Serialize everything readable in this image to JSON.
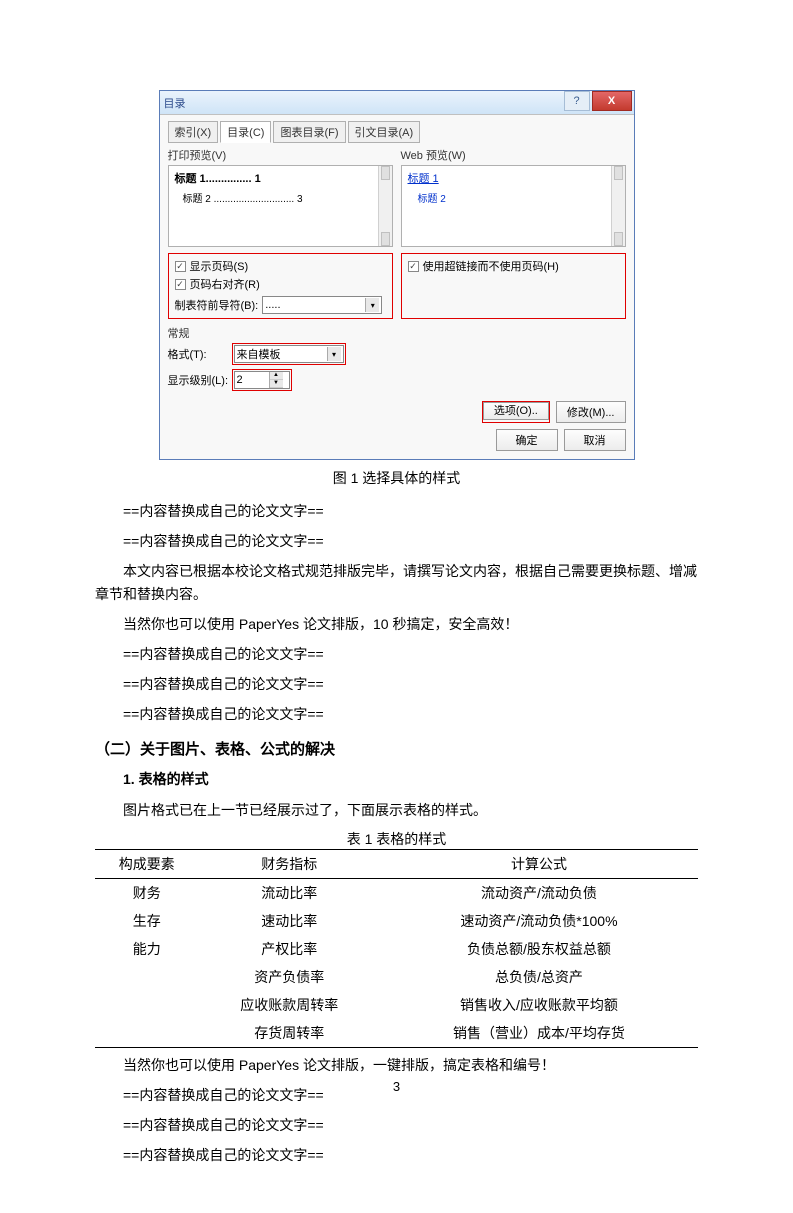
{
  "dialog": {
    "title": "目录",
    "help": "?",
    "close": "X",
    "tabs": [
      "索引(X)",
      "目录(C)",
      "图表目录(F)",
      "引文目录(A)"
    ],
    "preview_label_left": "打印预览(V)",
    "preview_label_right": "Web 预览(W)",
    "preview_left_line1": "标题 1............... 1",
    "preview_left_line2": "标题 2 ............................. 3",
    "preview_right_link": "标题 1",
    "preview_right_sub": "标题 2",
    "check_show_page": "显示页码(S)",
    "check_right_align": "页码右对齐(R)",
    "check_hyperlink": "使用超链接而不使用页码(H)",
    "leader_label": "制表符前导符(B):",
    "leader_value": ".....",
    "general_label": "常规",
    "format_label": "格式(T):",
    "format_value": "来自模板",
    "level_label": "显示级别(L):",
    "level_value": "2",
    "btn_options": "选项(O)..",
    "btn_modify": "修改(M)...",
    "btn_ok": "确定",
    "btn_cancel": "取消"
  },
  "caption1": "图 1  选择具体的样式",
  "p1": "==内容替换成自己的论文文字==",
  "p2": "==内容替换成自己的论文文字==",
  "p3": "本文内容已根据本校论文格式规范排版完毕，请撰写论文内容，根据自己需要更换标题、增减章节和替换内容。",
  "p4": "当然你也可以使用 PaperYes 论文排版，10 秒搞定，安全高效！",
  "p5": "==内容替换成自己的论文文字==",
  "p6": "==内容替换成自己的论文文字==",
  "p7": "==内容替换成自己的论文文字==",
  "h2": "（二）关于图片、表格、公式的解决",
  "h3": "1. 表格的样式",
  "p8": "图片格式已在上一节已经展示过了，下面展示表格的样式。",
  "table_caption": "表 1  表格的样式",
  "chart_data": {
    "type": "table",
    "columns": [
      "构成要素",
      "财务指标",
      "计算公式"
    ],
    "rows": [
      [
        "财务",
        "流动比率",
        "流动资产/流动负债"
      ],
      [
        "生存",
        "速动比率",
        "速动资产/流动负债*100%"
      ],
      [
        "能力",
        "产权比率",
        "负债总额/股东权益总额"
      ],
      [
        "",
        "资产负债率",
        "总负债/总资产"
      ],
      [
        "",
        "应收账款周转率",
        "销售收入/应收账款平均额"
      ],
      [
        "",
        "存货周转率",
        "销售（营业）成本/平均存货"
      ]
    ]
  },
  "p9": "当然你也可以使用 PaperYes 论文排版，一键排版，搞定表格和编号！",
  "p10": "==内容替换成自己的论文文字==",
  "p11": "==内容替换成自己的论文文字==",
  "p12": "==内容替换成自己的论文文字==",
  "page_number": "3"
}
